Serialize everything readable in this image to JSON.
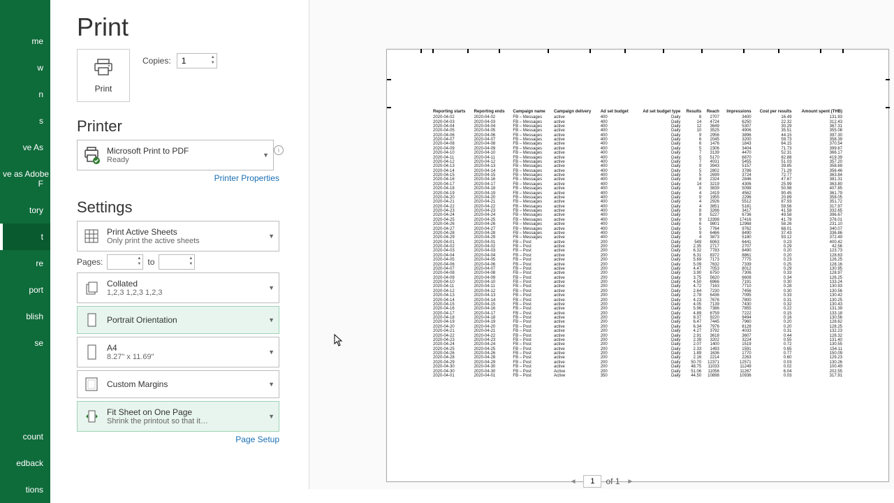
{
  "sidebar": {
    "items": [
      "me",
      "w",
      "n",
      "s",
      "ve As",
      "ve as Adobe\nF",
      "tory",
      "t",
      "re",
      "port",
      "blish",
      "se"
    ],
    "active_idx": 7,
    "bottom": [
      "count",
      "edback",
      "tions"
    ]
  },
  "title": "Print",
  "print_button": "Print",
  "copies_label": "Copies:",
  "copies_value": "1",
  "printer": {
    "heading": "Printer",
    "name": "Microsoft Print to PDF",
    "status": "Ready",
    "props_link": "Printer Properties"
  },
  "settings": {
    "heading": "Settings",
    "what": {
      "t1": "Print Active Sheets",
      "t2": "Only print the active sheets"
    },
    "pages_label": "Pages:",
    "to_label": "to",
    "page_from": "",
    "page_to": "",
    "collate": {
      "t1": "Collated",
      "t2": "1,2,3    1,2,3    1,2,3"
    },
    "orient": "Portrait Orientation",
    "paper": {
      "t1": "A4",
      "t2": "8.27\" x 11.69\""
    },
    "margins": "Custom Margins",
    "scale": {
      "t1": "Fit Sheet on One Page",
      "t2": "Shrink the printout so that it…"
    },
    "setup_link": "Page Setup"
  },
  "pager": {
    "current": "1",
    "total": "of 1"
  },
  "table": {
    "headers": [
      "Reporting starts",
      "Reporting ends",
      "Campaign name",
      "Campaign delivery",
      "Ad set budget",
      "Ad set budget type",
      "Results",
      "Reach",
      "Impressions",
      "Cost per results",
      "Amount spent (THB)"
    ],
    "rows": [
      [
        "2020-04-02",
        "2020-04-02",
        "FB – Messages",
        "active",
        "400",
        "Daily",
        "8",
        "2707",
        "3400",
        "16.49",
        "131.93"
      ],
      [
        "2020-04-03",
        "2020-04-03",
        "FB – Messages",
        "active",
        "400",
        "Daily",
        "14",
        "4724",
        "6250",
        "22.32",
        "312.43"
      ],
      [
        "2020-04-04",
        "2020-04-04",
        "FB – Messages",
        "active",
        "400",
        "Daily",
        "12",
        "3649",
        "5307",
        "30.29",
        "367.31"
      ],
      [
        "2020-04-05",
        "2020-04-05",
        "FB – Messages",
        "active",
        "400",
        "Daily",
        "10",
        "3525",
        "4906",
        "35.51",
        "355.08"
      ],
      [
        "2020-04-06",
        "2020-04-06",
        "FB – Messages",
        "active",
        "400",
        "Daily",
        "9",
        "2956",
        "3896",
        "44.15",
        "397.30"
      ],
      [
        "2020-04-07",
        "2020-04-07",
        "FB – Messages",
        "active",
        "400",
        "Daily",
        "6",
        "2045",
        "3200",
        "59.73",
        "358.39"
      ],
      [
        "2020-04-08",
        "2020-04-08",
        "FB – Messages",
        "active",
        "400",
        "Daily",
        "6",
        "1476",
        "1843",
        "64.15",
        "370.54"
      ],
      [
        "2020-04-09",
        "2020-04-09",
        "FB – Messages",
        "active",
        "400",
        "Daily",
        "5",
        "2306",
        "3404",
        "71.73",
        "399.67"
      ],
      [
        "2020-04-10",
        "2020-04-10",
        "FB – Messages",
        "active",
        "400",
        "Daily",
        "7",
        "3139",
        "4470",
        "52.31",
        "366.17"
      ],
      [
        "2020-04-11",
        "2020-04-11",
        "FB – Messages",
        "active",
        "400",
        "Daily",
        "5",
        "5170",
        "6870",
        "82.88",
        "419.39"
      ],
      [
        "2020-04-12",
        "2020-04-12",
        "FB – Messages",
        "active",
        "400",
        "Daily",
        "7",
        "4031",
        "5455",
        "51.03",
        "357.20"
      ],
      [
        "2020-04-13",
        "2020-04-13",
        "FB – Messages",
        "active",
        "400",
        "Daily",
        "9",
        "3943",
        "5157",
        "39.85",
        "358.69"
      ],
      [
        "2020-04-14",
        "2020-04-14",
        "FB – Messages",
        "active",
        "400",
        "Daily",
        "5",
        "2802",
        "3786",
        "71.29",
        "356.46"
      ],
      [
        "2020-04-15",
        "2020-04-15",
        "FB – Messages",
        "active",
        "400",
        "Daily",
        "5",
        "2699",
        "3724",
        "72.77",
        "363.84"
      ],
      [
        "2020-04-16",
        "2020-04-16",
        "FB – Messages",
        "active",
        "400",
        "Daily",
        "8",
        "2324",
        "2846",
        "47.67",
        "381.31"
      ],
      [
        "2020-04-17",
        "2020-04-17",
        "FB – Messages",
        "active",
        "400",
        "Daily",
        "14",
        "3219",
        "4306",
        "25.99",
        "363.80"
      ],
      [
        "2020-04-18",
        "2020-04-18",
        "FB – Messages",
        "active",
        "400",
        "Daily",
        "8",
        "3839",
        "5098",
        "50.98",
        "407.85"
      ],
      [
        "2020-04-19",
        "2020-04-19",
        "FB – Messages",
        "active",
        "400",
        "Daily",
        "4",
        "2419",
        "4562",
        "90.45",
        "361.79"
      ],
      [
        "2020-04-20",
        "2020-04-20",
        "FB – Messages",
        "active",
        "400",
        "Daily",
        "9",
        "1955",
        "2296",
        "20.89",
        "358.05"
      ],
      [
        "2020-04-21",
        "2020-04-21",
        "FB – Messages",
        "active",
        "400",
        "Daily",
        "4",
        "2926",
        "5512",
        "87.93",
        "351.72"
      ],
      [
        "2020-04-22",
        "2020-04-22",
        "FB – Messages",
        "active",
        "400",
        "Daily",
        "4",
        "3851",
        "5181",
        "59.56",
        "317.97"
      ],
      [
        "2020-04-23",
        "2020-04-23",
        "FB – Messages",
        "active",
        "400",
        "Daily",
        "8",
        "3266",
        "3417",
        "41.58",
        "332.65"
      ],
      [
        "2020-04-24",
        "2020-04-24",
        "FB – Messages",
        "active",
        "400",
        "Daily",
        "8",
        "5227",
        "6736",
        "49.58",
        "396.67"
      ],
      [
        "2020-04-25",
        "2020-04-25",
        "FB – Messages",
        "active",
        "400",
        "Daily",
        "9",
        "13398",
        "17416",
        "41.78",
        "376.01"
      ],
      [
        "2020-04-26",
        "2020-04-26",
        "FB – Messages",
        "active",
        "400",
        "Daily",
        "6",
        "9801",
        "12968",
        "58.26",
        "231.10"
      ],
      [
        "2020-04-27",
        "2020-04-27",
        "FB – Messages",
        "active",
        "400",
        "Daily",
        "5",
        "7764",
        "9762",
        "68.01",
        "340.07"
      ],
      [
        "2020-04-28",
        "2020-04-28",
        "FB – Messages",
        "active",
        "400",
        "Daily",
        "9",
        "6466",
        "8490",
        "37.43",
        "336.86"
      ],
      [
        "2020-04-29",
        "2020-04-29",
        "FB – Messages",
        "active",
        "400",
        "Daily",
        "4",
        "3873",
        "5180",
        "93.12",
        "372.49"
      ],
      [
        "2020-04-01",
        "2020-04-01",
        "FB – Post",
        "active",
        "200",
        "Daily",
        "549",
        "6063",
        "6441",
        "0.23",
        "400.42"
      ],
      [
        "2020-04-02",
        "2020-04-02",
        "FB – Post",
        "active",
        "200",
        "Daily",
        "2.35",
        "2717",
        "2707",
        "0.29",
        "42.56"
      ],
      [
        "2020-04-03",
        "2020-04-03",
        "FB – Post",
        "active",
        "200",
        "Daily",
        "6.32",
        "7783",
        "8490",
        "0.20",
        "123.73"
      ],
      [
        "2020-04-04",
        "2020-04-04",
        "FB – Post",
        "active",
        "200",
        "Daily",
        "6.31",
        "8372",
        "8861",
        "0.20",
        "128.63"
      ],
      [
        "2020-04-05",
        "2020-04-05",
        "FB – Post",
        "active",
        "200",
        "Daily",
        "5.69",
        "7173",
        "7775",
        "0.23",
        "126.25"
      ],
      [
        "2020-04-06",
        "2020-04-06",
        "FB – Post",
        "active",
        "200",
        "Daily",
        "5.09",
        "7632",
        "7339",
        "0.25",
        "128.16"
      ],
      [
        "2020-04-07",
        "2020-04-07",
        "FB – Post",
        "active",
        "200",
        "Daily",
        "4.47",
        "7053",
        "8012",
        "0.29",
        "130.95"
      ],
      [
        "2020-04-08",
        "2020-04-08",
        "FB – Post",
        "active",
        "200",
        "Daily",
        "3.90",
        "6750",
        "7306",
        "0.33",
        "128.97"
      ],
      [
        "2020-04-09",
        "2020-04-09",
        "FB – Post",
        "active",
        "200",
        "Daily",
        "3.75",
        "5620",
        "6608",
        "0.34",
        "126.25"
      ],
      [
        "2020-04-10",
        "2020-04-10",
        "FB – Post",
        "active",
        "200",
        "Daily",
        "4.50",
        "6966",
        "7191",
        "0.30",
        "133.24"
      ],
      [
        "2020-04-11",
        "2020-04-11",
        "FB – Post",
        "active",
        "200",
        "Daily",
        "4.72",
        "7163",
        "7710",
        "0.28",
        "130.93"
      ],
      [
        "2020-04-12",
        "2020-04-12",
        "FB – Post",
        "active",
        "200",
        "Daily",
        "2.64",
        "7230",
        "7456",
        "0.30",
        "130.56"
      ],
      [
        "2020-04-13",
        "2020-04-13",
        "FB – Post",
        "active",
        "200",
        "Daily",
        "2.78",
        "6436",
        "7095",
        "0.33",
        "130.42"
      ],
      [
        "2020-04-14",
        "2020-04-14",
        "FB – Post",
        "active",
        "200",
        "Daily",
        "4.23",
        "7676",
        "7800",
        "0.31",
        "130.25"
      ],
      [
        "2020-04-15",
        "2020-04-15",
        "FB – Post",
        "active",
        "200",
        "Daily",
        "4.05",
        "7139",
        "7430",
        "0.32",
        "130.43"
      ],
      [
        "2020-04-16",
        "2020-04-16",
        "FB – Post",
        "active",
        "200",
        "Daily",
        "5.96",
        "7386",
        "7855",
        "0.22",
        "131.39"
      ],
      [
        "2020-04-17",
        "2020-04-17",
        "FB – Post",
        "active",
        "200",
        "Daily",
        "4.89",
        "6759",
        "7222",
        "0.15",
        "133.18"
      ],
      [
        "2020-04-18",
        "2020-04-18",
        "FB – Post",
        "active",
        "200",
        "Daily",
        "8.37",
        "9220",
        "9494",
        "0.16",
        "130.56"
      ],
      [
        "2020-04-19",
        "2020-04-19",
        "FB – Post",
        "active",
        "200",
        "Daily",
        "6.47",
        "7445",
        "7960",
        "0.20",
        "128.62"
      ],
      [
        "2020-04-20",
        "2020-04-20",
        "FB – Post",
        "active",
        "200",
        "Daily",
        "6.34",
        "7976",
        "8128",
        "0.20",
        "128.25"
      ],
      [
        "2020-04-21",
        "2020-04-21",
        "FB – Post",
        "active",
        "200",
        "Daily",
        "4.27",
        "3792",
        "4033",
        "0.31",
        "132.23"
      ],
      [
        "2020-04-22",
        "2020-04-22",
        "FB – Post",
        "active",
        "200",
        "Daily",
        "2.91",
        "3618",
        "3607",
        "0.44",
        "128.32"
      ],
      [
        "2020-04-23",
        "2020-04-23",
        "FB – Post",
        "active",
        "200",
        "Daily",
        "2.39",
        "3202",
        "3224",
        "0.55",
        "131.40"
      ],
      [
        "2020-04-24",
        "2020-04-24",
        "FB – Post",
        "active",
        "200",
        "Daily",
        "2.07",
        "1400",
        "1519",
        "0.72",
        "130.55"
      ],
      [
        "2020-04-25",
        "2020-04-25",
        "FB – Post",
        "active",
        "200",
        "Daily",
        "2.33",
        "1493",
        "1591",
        "0.65",
        "154.11"
      ],
      [
        "2020-04-26",
        "2020-04-26",
        "FB – Post",
        "active",
        "200",
        "Daily",
        "1.89",
        "1636",
        "1770",
        "0.77",
        "150.09"
      ],
      [
        "2020-04-28",
        "2020-04-28",
        "FB – Post",
        "active",
        "200",
        "Daily",
        "2.16",
        "2214",
        "2263",
        "0.60",
        "129.23"
      ],
      [
        "2020-04-29",
        "2020-04-29",
        "FB – Post",
        "active",
        "200",
        "Daily",
        "50.70",
        "12371",
        "12571",
        "0.03",
        "130.26"
      ],
      [
        "2020-04-30",
        "2020-04-30",
        "FB – Post",
        "active",
        "200",
        "Daily",
        "48.75",
        "11033",
        "11249",
        "0.02",
        "100.49"
      ],
      [
        "2020-04-30",
        "2020-04-30",
        "FB – Post",
        "Active",
        "200",
        "Daily",
        "51.06",
        "11056",
        "11267",
        "6.04",
        "202.55"
      ],
      [
        "2020-04-01",
        "2020-04-01",
        "FB – Post",
        "Active",
        "350",
        "Daily",
        "44.50",
        "10898",
        "10936",
        "0.03",
        "317.91"
      ]
    ]
  }
}
